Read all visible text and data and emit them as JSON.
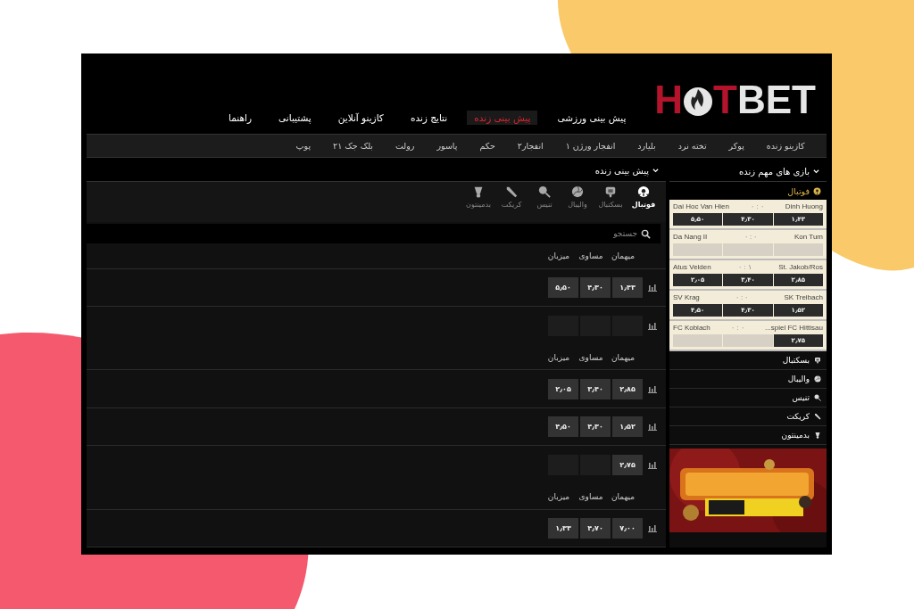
{
  "logo": {
    "part_1": "H",
    "part_2": "T",
    "part_3": "BET"
  },
  "nav": [
    {
      "label": "پیش بینی ورزشی",
      "selected": false
    },
    {
      "label": "پیش بینی زنده",
      "selected": true
    },
    {
      "label": "نتایج زنده",
      "selected": false
    },
    {
      "label": "کازینو آنلاین",
      "selected": false
    },
    {
      "label": "پشتیبانی",
      "selected": false
    },
    {
      "label": "راهنما",
      "selected": false
    }
  ],
  "subnav": [
    "کازینو زنده",
    "پوکر",
    "تخته نرد",
    "بلیارد",
    "انفجار ورژن ۱",
    "انفجار۲",
    "حکم",
    "پاسور",
    "رولت",
    "بلک جک ۲۱",
    "پوپ"
  ],
  "main": {
    "title": "پیش بینی زنده",
    "sports": [
      {
        "label": "فوتبال",
        "kind": "football",
        "selected": true
      },
      {
        "label": "بسکتبال",
        "kind": "basketball",
        "selected": false
      },
      {
        "label": "والیبال",
        "kind": "volleyball",
        "selected": false
      },
      {
        "label": "تنیس",
        "kind": "tennis",
        "selected": false
      },
      {
        "label": "کریکت",
        "kind": "cricket",
        "selected": false
      },
      {
        "label": "بدمینتون",
        "kind": "badminton",
        "selected": false
      }
    ],
    "search": {
      "placeholder": "جستجو"
    },
    "rows": [
      {
        "kind": "header",
        "labels": [
          "میهمان",
          "مساوی",
          "میزبان"
        ]
      },
      {
        "kind": "odds",
        "odds": [
          "۱٫۴۳",
          "۴٫۳۰",
          "۵٫۵۰"
        ]
      },
      {
        "kind": "odds"
      },
      {
        "kind": "header",
        "labels": [
          "میهمان",
          "مساوی",
          "میزبان"
        ]
      },
      {
        "kind": "odds",
        "odds": [
          "۲٫۸۵",
          "۳٫۴۰",
          "۲٫۰۵"
        ]
      },
      {
        "kind": "odds",
        "odds": [
          "۱٫۵۲",
          "۴٫۳۰",
          "۴٫۵۰"
        ]
      },
      {
        "kind": "odds",
        "odds": [
          "۲٫۷۵"
        ]
      },
      {
        "kind": "header",
        "labels": [
          "میهمان",
          "مساوی",
          "میزبان"
        ]
      },
      {
        "kind": "odds",
        "odds": [
          "۷٫۰۰",
          "۴٫۷۰",
          "۱٫۳۳"
        ]
      }
    ]
  },
  "sidebar": {
    "title": "بازی های مهم زنده",
    "category": "فوتبال",
    "matches": [
      {
        "left_team": "Dai Hoc Van Hien",
        "score": "۰ : ۰",
        "right_team": "Dinh Huong",
        "odds": [
          "۱٫۴۳",
          "۴٫۳۰",
          "۵٫۵۰"
        ]
      },
      {
        "left_team": "Da Nang II",
        "score": "۰ : ۰",
        "right_team": "Kon Tum"
      },
      {
        "left_team": "Atus Velden",
        "score": "۰ : ۱",
        "right_team": "St. Jakob/Ros",
        "odds": [
          "۲٫۸۵",
          "۳٫۴۰",
          "۲٫۰۵"
        ]
      },
      {
        "left_team": "SV Krag",
        "score": "۰ : ۰",
        "right_team": "SK Treibach",
        "odds": [
          "۱٫۵۲",
          "۴٫۳۰",
          "۴٫۵۰"
        ]
      },
      {
        "left_team": "FC Koblach",
        "score": "۰ : ۰",
        "right_team": "...spiel FC Hittisau",
        "odds": [
          "۲٫۷۵"
        ]
      }
    ],
    "sports": [
      {
        "label": "بسکتبال",
        "kind": "basketball"
      },
      {
        "label": "والیبال",
        "kind": "volleyball"
      },
      {
        "label": "تنیس",
        "kind": "tennis"
      },
      {
        "label": "کریکت",
        "kind": "cricket"
      },
      {
        "label": "بدمینتون",
        "kind": "badminton"
      }
    ]
  }
}
